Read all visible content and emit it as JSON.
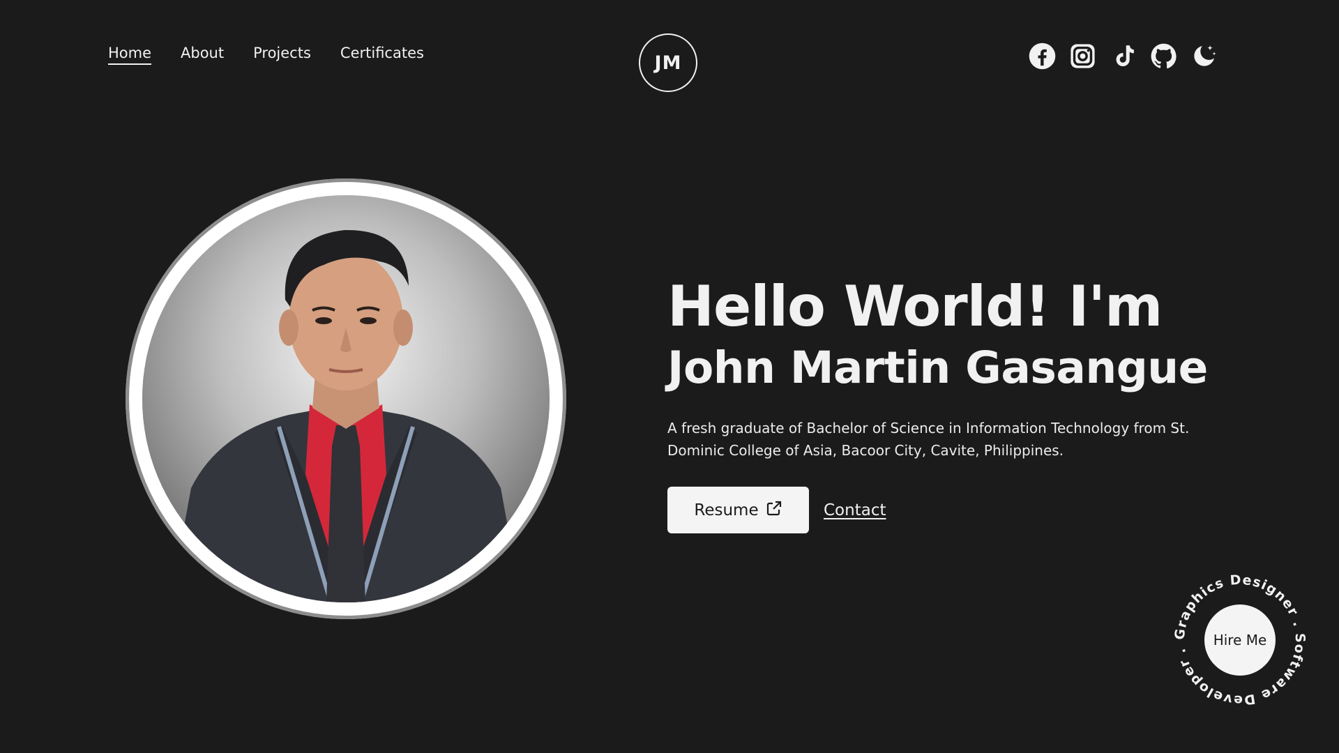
{
  "nav": {
    "items": [
      {
        "label": "Home",
        "active": true
      },
      {
        "label": "About",
        "active": false
      },
      {
        "label": "Projects",
        "active": false
      },
      {
        "label": "Certificates",
        "active": false
      }
    ]
  },
  "logo": {
    "text": "JM"
  },
  "socials": [
    "facebook-icon",
    "instagram-icon",
    "tiktok-icon",
    "github-icon",
    "moon-icon"
  ],
  "hero": {
    "greeting": "Hello World! I'm",
    "name": "John Martin Gasangue",
    "description": "A fresh graduate of Bachelor of Science in Information Technology from St. Dominic College of Asia, Bacoor City, Cavite, Philippines.",
    "resume_label": "Resume",
    "contact_label": "Contact"
  },
  "hire": {
    "label": "Hire Me",
    "ring_text": "Graphics Designer . Software Developer . "
  },
  "colors": {
    "background": "#1b1b1b",
    "foreground": "#f1f1f1",
    "button_bg": "#f4f4f4",
    "button_text": "#1b1b1b"
  }
}
